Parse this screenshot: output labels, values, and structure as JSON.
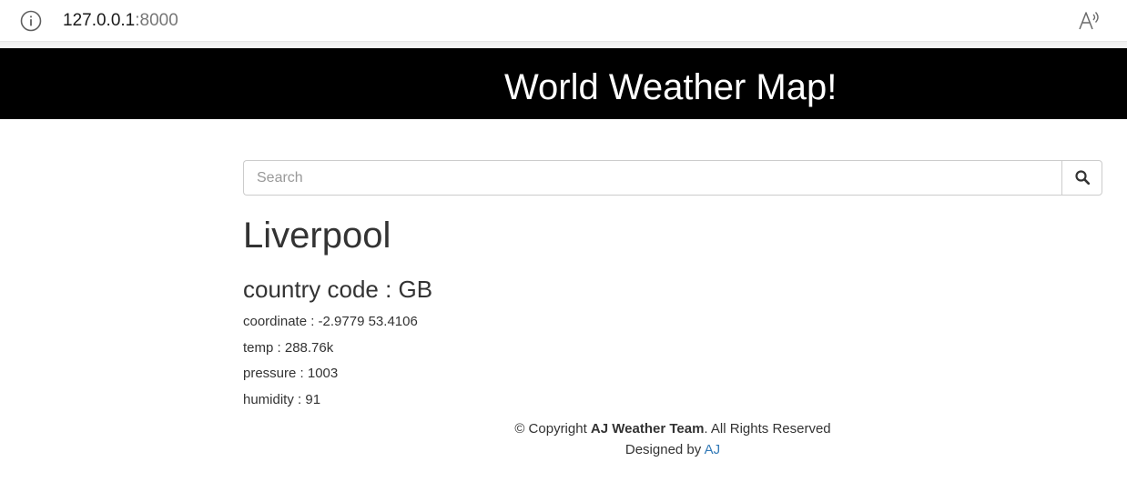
{
  "browser": {
    "url_host": "127.0.0.1",
    "url_port": ":8000"
  },
  "header": {
    "title": "World Weather Map!"
  },
  "search": {
    "placeholder": "Search",
    "value": ""
  },
  "weather": {
    "city": "Liverpool",
    "country_code": "country code : GB",
    "coordinate": "coordinate : -2.9779 53.4106",
    "temp": "temp : 288.76k",
    "pressure": "pressure : 1003",
    "humidity": "humidity : 91"
  },
  "footer": {
    "copyright_prefix": "© Copyright ",
    "team": "AJ Weather Team",
    "rights": ". All Rights Reserved",
    "designed_by": "Designed by ",
    "designer": "AJ"
  },
  "colors": {
    "banner_bg": "#000000",
    "banner_text": "#ffffff",
    "link": "#337ab7"
  },
  "icons": {
    "info": "info-icon",
    "read_aloud": "read-aloud-icon",
    "search": "search-icon"
  }
}
